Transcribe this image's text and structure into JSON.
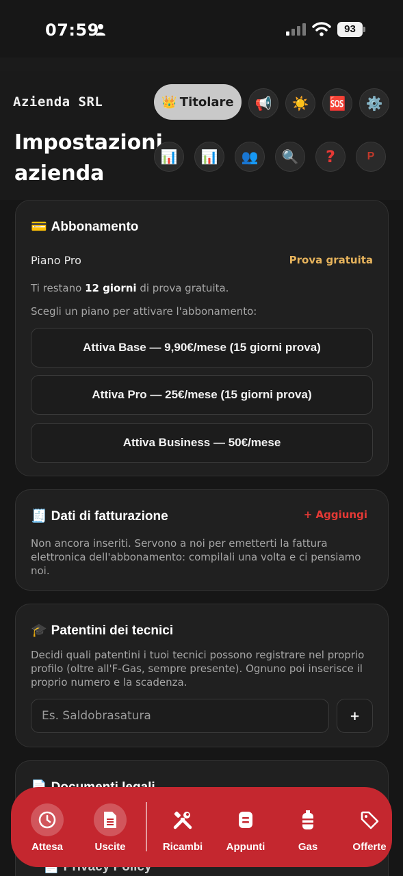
{
  "status_bar": {
    "time": "07:59",
    "battery": "93"
  },
  "header": {
    "company": "Azienda SRL",
    "role_label": "Titolare",
    "page_title": "Impostazioni azienda",
    "icons": [
      "megaphone-icon",
      "sun-icon",
      "sos-icon",
      "gear-icon",
      "chart-icon",
      "chart-icon",
      "users-icon",
      "search-icon",
      "help-icon",
      "profile-p-icon"
    ],
    "profile_letter": "P"
  },
  "subscription": {
    "title": "Abbonamento",
    "plan_name": "Piano Pro",
    "plan_status": "Prova gratuita",
    "trial_prefix": "Ti restano",
    "trial_days": "12 giorni",
    "trial_suffix": "di prova gratuita.",
    "choose_text": "Scegli un piano per attivare l'abbonamento:",
    "buttons": [
      "Attiva Base — 9,90€/mese (15 giorni prova)",
      "Attiva Pro — 25€/mese (15 giorni prova)",
      "Attiva Business — 50€/mese"
    ]
  },
  "billing": {
    "title": "Dati di fatturazione",
    "add_label": "+ Aggiungi",
    "description": "Non ancora inseriti. Servono a noi per emetterti la fattura elettronica dell'abbonamento: compilali una volta e ci pensiamo noi."
  },
  "licenses": {
    "title": "Patentini dei tecnici",
    "description": "Decidi quali patentini i tuoi tecnici possono registrare nel proprio profilo (oltre all'F-Gas, sempre presente). Ognuno poi inserisce il proprio numero e la scadenza.",
    "input_placeholder": "Es. Saldobrasatura",
    "add_button": "+"
  },
  "legal": {
    "title": "Documenti legali",
    "privacy_label": "Privacy Policy"
  },
  "bottom_nav": {
    "items": [
      {
        "label": "Attesa",
        "icon": "clock-icon"
      },
      {
        "label": "Uscite",
        "icon": "document-icon"
      },
      {
        "label": "Ricambi",
        "icon": "tools-icon"
      },
      {
        "label": "Appunti",
        "icon": "notes-icon"
      },
      {
        "label": "Gas",
        "icon": "gas-cylinder-icon"
      },
      {
        "label": "Offerte",
        "icon": "tag-icon"
      }
    ]
  },
  "colors": {
    "accent_red": "#c4272f",
    "trial_gold": "#e6b35c",
    "link_red": "#e53935"
  }
}
